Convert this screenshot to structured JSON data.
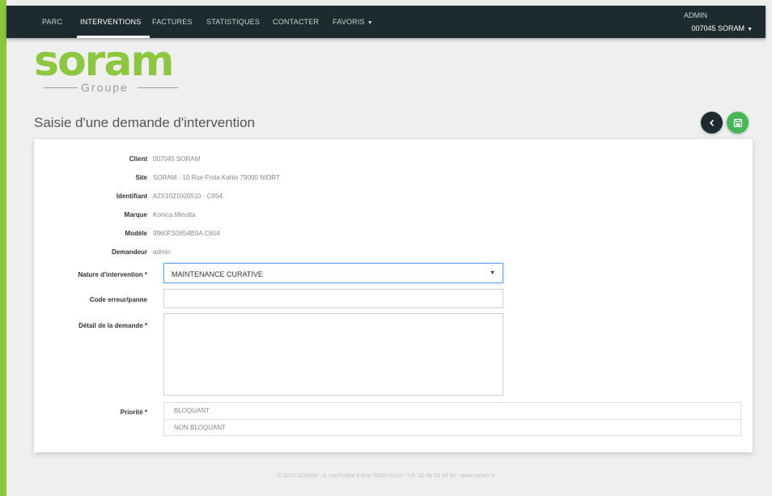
{
  "nav": {
    "items": [
      {
        "label": "PARC",
        "active": false
      },
      {
        "label": "INTERVENTIONS",
        "active": true
      },
      {
        "label": "FACTURES",
        "active": false
      },
      {
        "label": "STATISTIQUES",
        "active": false
      },
      {
        "label": "CONTACTER",
        "active": false
      },
      {
        "label": "FAVORIS",
        "active": false,
        "has_caret": true
      }
    ],
    "caret_icon": "caret-down-icon"
  },
  "user": {
    "name": "ADMIN",
    "account": "007045 SORAM"
  },
  "logo": {
    "word": "soram",
    "sub": "Groupe"
  },
  "page": {
    "title": "Saisie d'une demande d'intervention"
  },
  "actions": {
    "back_icon": "chevron-left-icon",
    "save_icon": "floppy-disk-icon"
  },
  "form": {
    "client_label": "Client",
    "client_value": "007045 SORAM",
    "site_label": "Site",
    "site_value": "SORAM - 10 Rue Frida Kahlo 79000 NIORT",
    "identifiant_label": "Identifiant",
    "identifiant_value": "A2X1021000510 - C654",
    "marque_label": "Marque",
    "marque_value": "Konica Minolta",
    "modele_label": "Modèle",
    "modele_value": "9960FS0654BSA C654",
    "demandeur_label": "Demandeur",
    "demandeur_value": "admin",
    "nature_label": "Nature d'intervention *",
    "nature_value": "MAINTENANCE CURATIVE",
    "code_label": "Code erreur/panne",
    "code_value": "",
    "detail_label": "Détail de la demande *",
    "detail_value": "",
    "priorite_label": "Priorité *",
    "priorite_options": [
      "BLOQUANT",
      "NON BLOQUANT"
    ]
  },
  "footer": {
    "text": "© 2019 SORAM - 8, rue Fridda Kahlo 79000 Niort - Tél. 05 49 33 39 50 - www.soram.fr"
  },
  "colors": {
    "brand_green": "#8dc63f",
    "navbar_bg": "#1e2b2e",
    "save_green": "#45b756"
  }
}
